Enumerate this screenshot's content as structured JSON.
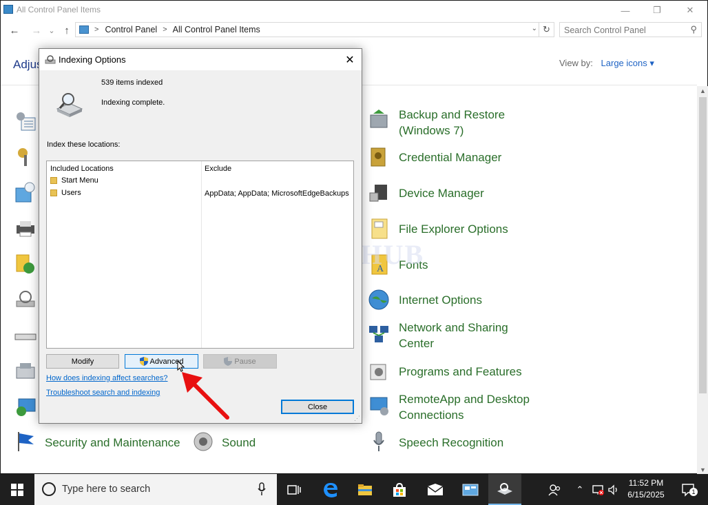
{
  "window": {
    "title": "All Control Panel Items",
    "minimize": "—",
    "maximize": "❐",
    "close": "✕"
  },
  "nav": {
    "back": "←",
    "forward": "→",
    "recent": "⌄",
    "up": "↑",
    "breadcrumb": [
      "Control Panel",
      "All Control Panel Items"
    ],
    "separator": ">",
    "refresh": "↻",
    "search_placeholder": "Search Control Panel"
  },
  "content": {
    "heading": "Adjus",
    "view_by_label": "View by:",
    "view_by_value": "Large icons ▾"
  },
  "watermark": "IT Pros HUB",
  "cp_items_right": [
    "Backup and Restore (Windows 7)",
    "Credential Manager",
    "Device Manager",
    "File Explorer Options",
    "Fonts",
    "Internet Options",
    "Network and Sharing Center",
    "Programs and Features",
    "RemoteApp and Desktop Connections",
    "Speech Recognition"
  ],
  "cp_items_bottom": [
    "Security and Maintenance",
    "Sound"
  ],
  "dialog": {
    "title": "Indexing Options",
    "close": "✕",
    "items_indexed": "539 items indexed",
    "status": "Indexing complete.",
    "locations_label": "Index these locations:",
    "col_included": "Included Locations",
    "col_exclude": "Exclude",
    "rows": [
      {
        "location": "Start Menu",
        "exclude": ""
      },
      {
        "location": "Users",
        "exclude": "AppData; AppData; MicrosoftEdgeBackups"
      }
    ],
    "modify": "Modify",
    "advanced": "Advanced",
    "pause": "Pause",
    "link_affect": "How does indexing affect searches?",
    "link_troubleshoot": "Troubleshoot search and indexing",
    "close_button": "Close"
  },
  "taskbar": {
    "search_placeholder": "Type here to search",
    "time": "11:52 PM",
    "date": "6/15/2025",
    "notification_count": "1"
  },
  "colors": {
    "accent": "#0078d7",
    "cp_link": "#2a6e2a",
    "arrow": "#e81010"
  }
}
